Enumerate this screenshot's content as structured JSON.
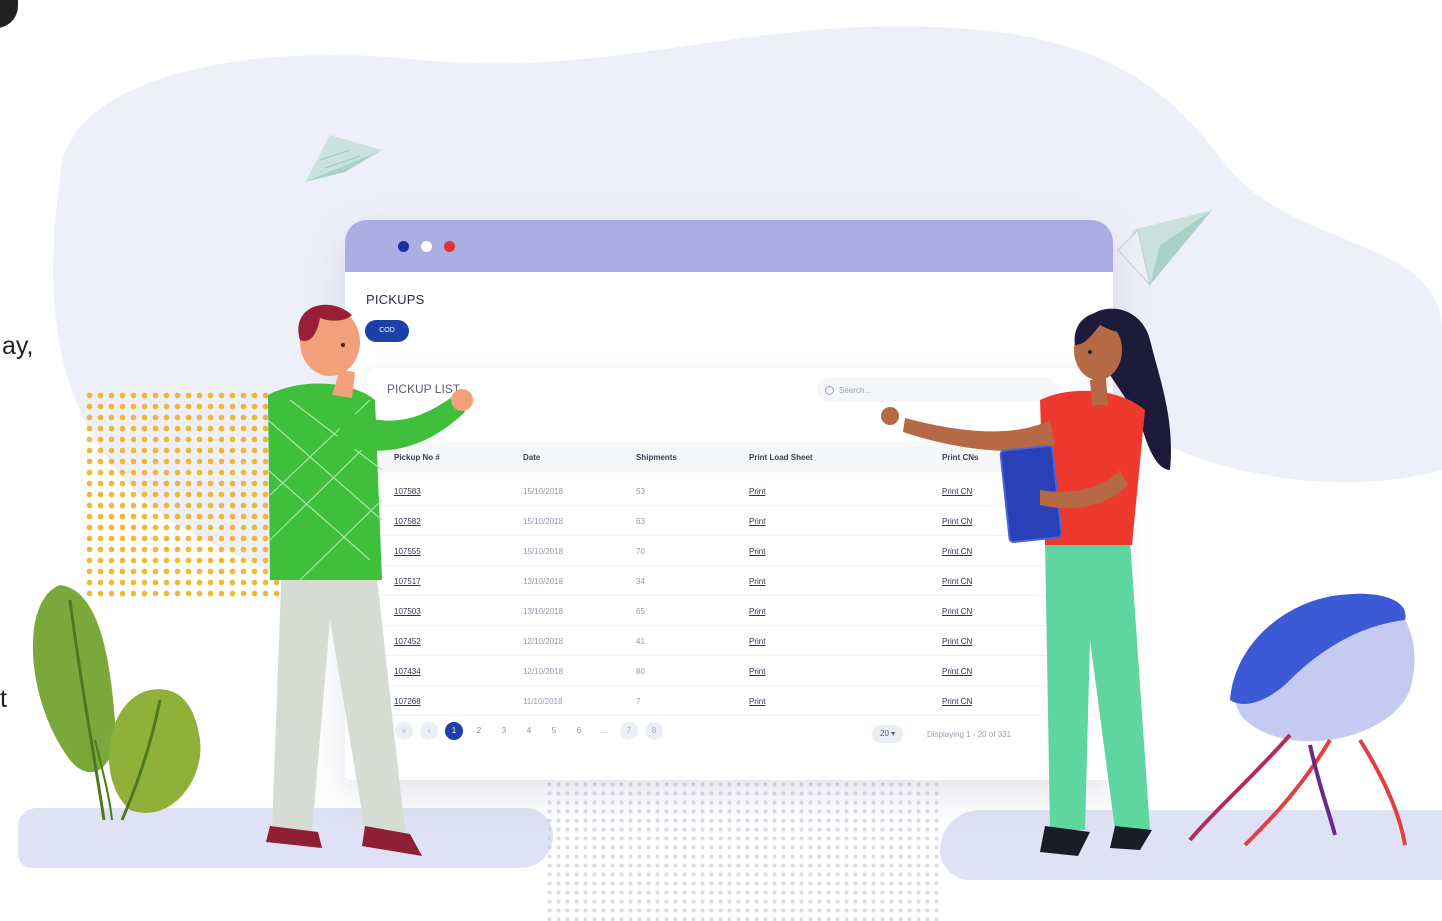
{
  "left_fragments": {
    "line1": "ay,",
    "line2": "t"
  },
  "window": {
    "traffic_dots": [
      "#1d2fa3",
      "#ffffff",
      "#e53030"
    ],
    "page_title": "PICKUPS",
    "pill_label": "COD",
    "card_title": "PICKUP LIST",
    "search_placeholder": "Search...",
    "table": {
      "headers": [
        "Pickup No #",
        "Date",
        "Shipments",
        "Print Load Sheet",
        "Print CNs"
      ],
      "rows": [
        [
          "107583",
          "15/10/2018",
          "53",
          "Print",
          "Print CN"
        ],
        [
          "107582",
          "15/10/2018",
          "63",
          "Print",
          "Print CN"
        ],
        [
          "107555",
          "15/10/2018",
          "70",
          "Print",
          "Print CN"
        ],
        [
          "107517",
          "13/10/2018",
          "34",
          "Print",
          "Print CN"
        ],
        [
          "107503",
          "13/10/2018",
          "65",
          "Print",
          "Print CN"
        ],
        [
          "107452",
          "12/10/2018",
          "41",
          "Print",
          "Print CN"
        ],
        [
          "107434",
          "12/10/2018",
          "80",
          "Print",
          "Print CN"
        ],
        [
          "107268",
          "11/10/2018",
          "7",
          "Print",
          "Print CN"
        ]
      ]
    },
    "pagination": {
      "pages": [
        "1",
        "2",
        "3",
        "4",
        "5",
        "6",
        "...",
        "7",
        "8"
      ],
      "active": "1",
      "per_page": "20",
      "displaying": "Displaying 1 - 20 of 331"
    }
  },
  "colors": {
    "accent": "#1e3ea8",
    "titlebar": "#abaee2",
    "man_sweater": "#3fbf3c",
    "woman_top": "#ee3a2e",
    "pants_mint": "#5fd6a0"
  }
}
